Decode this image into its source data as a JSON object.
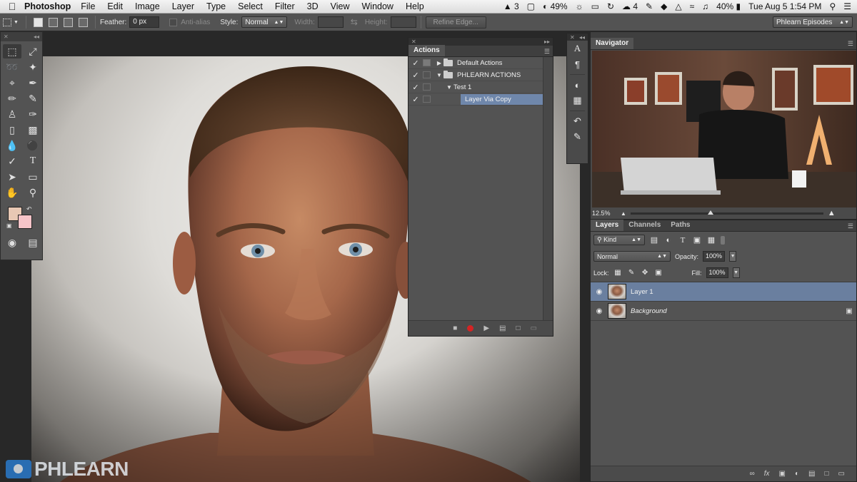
{
  "menubar": {
    "app_name": "Photoshop",
    "items": [
      "File",
      "Edit",
      "Image",
      "Layer",
      "Type",
      "Select",
      "Filter",
      "3D",
      "View",
      "Window",
      "Help"
    ],
    "status": {
      "adobe_count": "3",
      "battery_small": "49%",
      "notification_count": "4",
      "battery": "40%",
      "clock": "Tue Aug 5  1:54 PM"
    }
  },
  "optionsbar": {
    "feather_label": "Feather:",
    "feather_value": "0 px",
    "antialias_label": "Anti-alias",
    "style_label": "Style:",
    "style_value": "Normal",
    "width_label": "Width:",
    "height_label": "Height:",
    "refine_edge": "Refine Edge...",
    "workspace": "Phlearn Episodes"
  },
  "actions_panel": {
    "tab": "Actions",
    "rows": [
      {
        "checked": true,
        "label": "Default Actions",
        "type": "set",
        "expanded": false
      },
      {
        "checked": true,
        "label": "PHLEARN ACTIONS",
        "type": "set",
        "expanded": true
      },
      {
        "checked": true,
        "label": "Test 1",
        "type": "action",
        "expanded": true
      },
      {
        "checked": true,
        "label": "Layer Via Copy",
        "type": "step",
        "selected": true
      }
    ]
  },
  "navigator": {
    "tab": "Navigator",
    "zoom": "12.5%",
    "zoom_slider_level": 0.4
  },
  "layers_panel": {
    "tabs": [
      "Layers",
      "Channels",
      "Paths"
    ],
    "filter_kind": "Kind",
    "blend_mode": "Normal",
    "opacity_label": "Opacity:",
    "opacity_value": "100%",
    "lock_label": "Lock:",
    "fill_label": "Fill:",
    "fill_value": "100%",
    "layers": [
      {
        "name": "Layer 1",
        "visible": true,
        "selected": true,
        "locked": false
      },
      {
        "name": "Background",
        "visible": true,
        "selected": false,
        "locked": true
      }
    ]
  },
  "tools": {
    "foreground_color": "#e8c8b4",
    "background_color": "#f6c4c8"
  },
  "watermark": {
    "text": "PHLEARN"
  },
  "colors": {
    "panel": "#535353",
    "selection": "#6f87ab",
    "record": "#d42424",
    "brand_blue": "#2a7dd1"
  }
}
